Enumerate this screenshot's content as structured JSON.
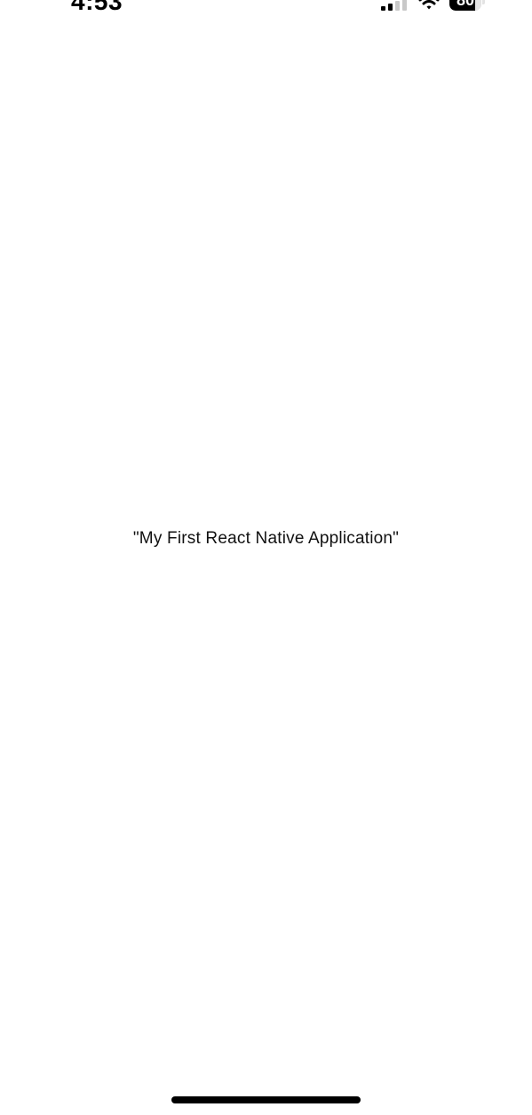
{
  "status_bar": {
    "time": "4:53",
    "signal_icon": "cellular-signal-icon",
    "signal_bars_active": 2,
    "signal_bars_total": 4,
    "wifi_icon": "wifi-icon",
    "battery_icon": "battery-icon",
    "battery_level": "80",
    "battery_fraction": 0.8
  },
  "main": {
    "text": "\"My First React Native Application\""
  },
  "colors": {
    "background": "#ffffff",
    "text": "#000000",
    "inactive_signal": "#c8c8c8"
  }
}
